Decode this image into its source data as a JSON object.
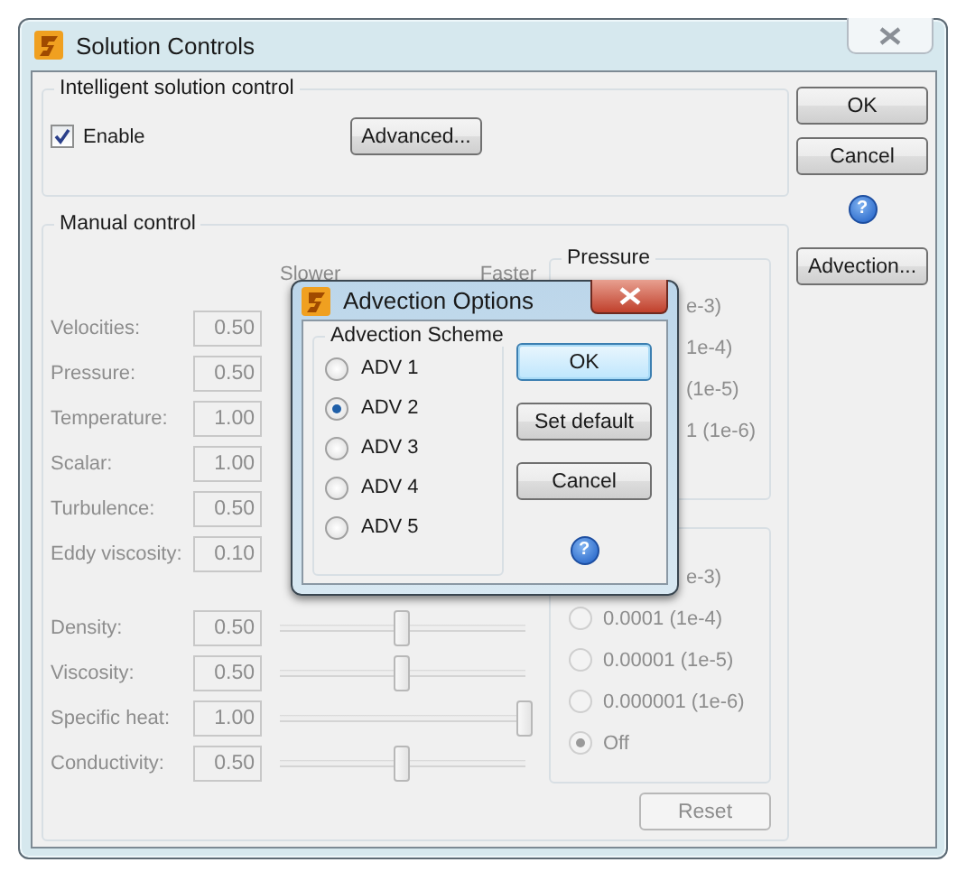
{
  "window": {
    "title": "Solution Controls"
  },
  "intelligent_control": {
    "title": "Intelligent solution control",
    "enable": {
      "label": "Enable",
      "checked": true
    },
    "advanced_button": "Advanced..."
  },
  "manual_control": {
    "title": "Manual control",
    "disabled": true,
    "slower_label": "Slower",
    "faster_label": "Faster",
    "rows": [
      {
        "label": "Velocities:",
        "value": "0.50"
      },
      {
        "label": "Pressure:",
        "value": "0.50"
      },
      {
        "label": "Temperature:",
        "value": "1.00"
      },
      {
        "label": "Scalar:",
        "value": "1.00"
      },
      {
        "label": "Turbulence:",
        "value": "0.50"
      },
      {
        "label": "Eddy viscosity:",
        "value": "0.10"
      },
      {
        "label": "Density:",
        "value": "0.50",
        "level": 0.5
      },
      {
        "label": "Viscosity:",
        "value": "0.50",
        "level": 0.5
      },
      {
        "label": "Specific heat:",
        "value": "1.00",
        "level": 1
      },
      {
        "label": "Conductivity:",
        "value": "0.50",
        "level": 0.5
      }
    ],
    "pressure_group": {
      "title": "Pressure",
      "items": [
        "e-3)",
        "1e-4)",
        "(1e-5)",
        "1 (1e-6)"
      ]
    },
    "second_group": {
      "items": [
        {
          "label": "e-3)",
          "kind": "fragment"
        },
        {
          "label": "0.0001 (1e-4)",
          "kind": "radio",
          "selected": false
        },
        {
          "label": "0.00001 (1e-5)",
          "kind": "radio",
          "selected": false
        },
        {
          "label": "0.000001 (1e-6)",
          "kind": "radio",
          "selected": false
        },
        {
          "label": "Off",
          "kind": "radio",
          "selected": true
        }
      ]
    },
    "reset_button": "Reset"
  },
  "side_buttons": {
    "ok": "OK",
    "cancel": "Cancel",
    "help": "?",
    "advection": "Advection..."
  },
  "dialog": {
    "title": "Advection Options",
    "group_title": "Advection Scheme",
    "options": [
      {
        "label": "ADV 1",
        "selected": false
      },
      {
        "label": "ADV 2",
        "selected": true
      },
      {
        "label": "ADV 3",
        "selected": false
      },
      {
        "label": "ADV 4",
        "selected": false
      },
      {
        "label": "ADV 5",
        "selected": false
      }
    ],
    "buttons": [
      {
        "label": "OK",
        "default": true
      },
      {
        "label": "Set default",
        "default": false
      },
      {
        "label": "Cancel",
        "default": false
      }
    ],
    "help": "?"
  }
}
